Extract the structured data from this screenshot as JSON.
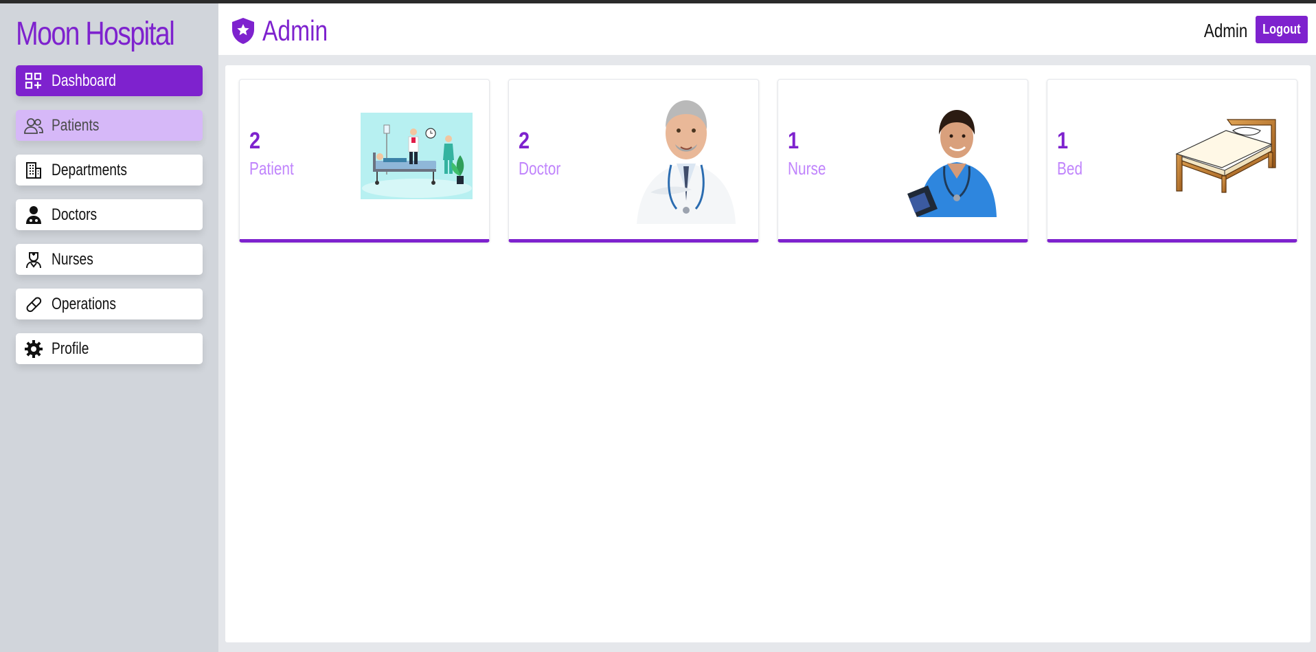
{
  "app": {
    "name": "Moon Hospital"
  },
  "sidebar": {
    "items": [
      {
        "label": "Dashboard",
        "icon": "dashboard-icon",
        "state": "active"
      },
      {
        "label": "Patients",
        "icon": "patients-icon",
        "state": "hover"
      },
      {
        "label": "Departments",
        "icon": "building-icon",
        "state": "normal"
      },
      {
        "label": "Doctors",
        "icon": "doctor-icon",
        "state": "normal"
      },
      {
        "label": "Nurses",
        "icon": "nurse-icon",
        "state": "normal"
      },
      {
        "label": "Operations",
        "icon": "bandage-icon",
        "state": "normal"
      },
      {
        "label": "Profile",
        "icon": "gear-icon",
        "state": "normal"
      }
    ]
  },
  "header": {
    "title": "Admin",
    "title_icon": "shield-star-icon",
    "user": "Admin",
    "logout_label": "Logout"
  },
  "cards": [
    {
      "count": "2",
      "label": "Patient",
      "image": "hospital-ward-illustration"
    },
    {
      "count": "2",
      "label": "Doctor",
      "image": "doctor-photo"
    },
    {
      "count": "1",
      "label": "Nurse",
      "image": "nurse-photo"
    },
    {
      "count": "1",
      "label": "Bed",
      "image": "bed-illustration"
    }
  ],
  "colors": {
    "accent": "#7e22ce",
    "accent_light": "#c084fc",
    "hover_bg": "#d8b4fe",
    "sidebar_bg": "#d1d5db",
    "page_bg": "#e5e7eb"
  }
}
